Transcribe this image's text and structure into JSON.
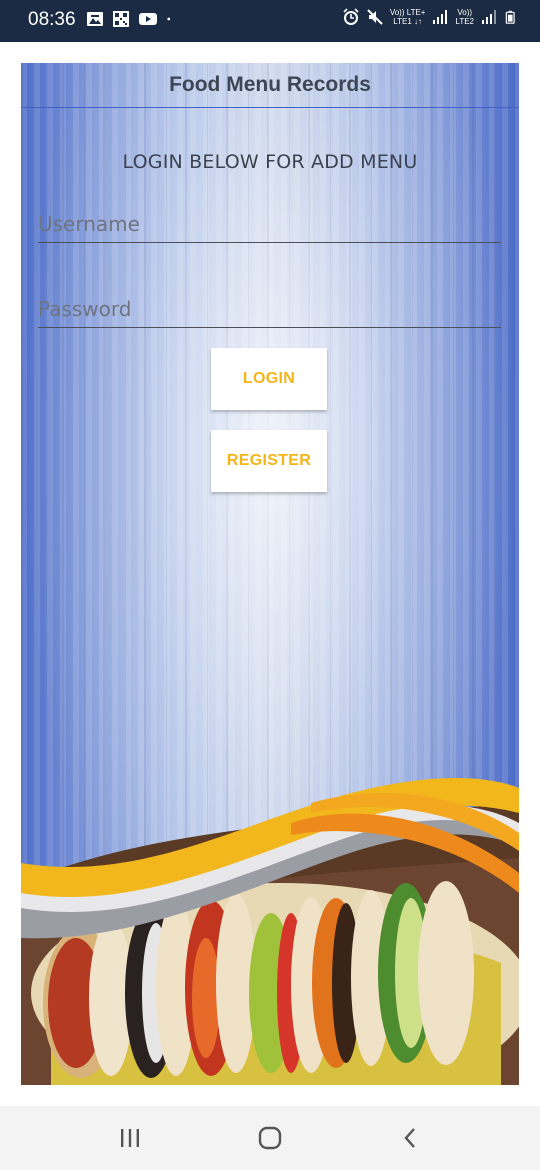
{
  "status_bar": {
    "time": "08:36",
    "notification_icons": [
      "gallery-icon",
      "qr-icon",
      "youtube-icon",
      "dot-icon"
    ],
    "right_icons": [
      "alarm-icon",
      "mute-icon",
      "signal-icon",
      "signal-icon",
      "battery-icon"
    ],
    "network": {
      "sim1_top": "Vo)) LTE+",
      "sim1_bottom": "LTE1 ↓↑",
      "sim2_top": "Vo))",
      "sim2_bottom": "LTE2"
    }
  },
  "app": {
    "title": "Food Menu Records",
    "subtitle": "LOGIN BELOW FOR ADD MENU",
    "username_placeholder": "Username",
    "password_placeholder": "Password",
    "username_value": "",
    "password_value": "",
    "login_label": "LOGIN",
    "register_label": "REGISTER"
  },
  "colors": {
    "status_bar_bg": "#1c2b44",
    "button_text": "#f4b41a",
    "title_text": "#3e4554",
    "panel_blue": "#4f6fc9"
  },
  "nav_bar": {
    "icons": [
      "recent-apps-icon",
      "home-icon",
      "back-icon"
    ]
  }
}
